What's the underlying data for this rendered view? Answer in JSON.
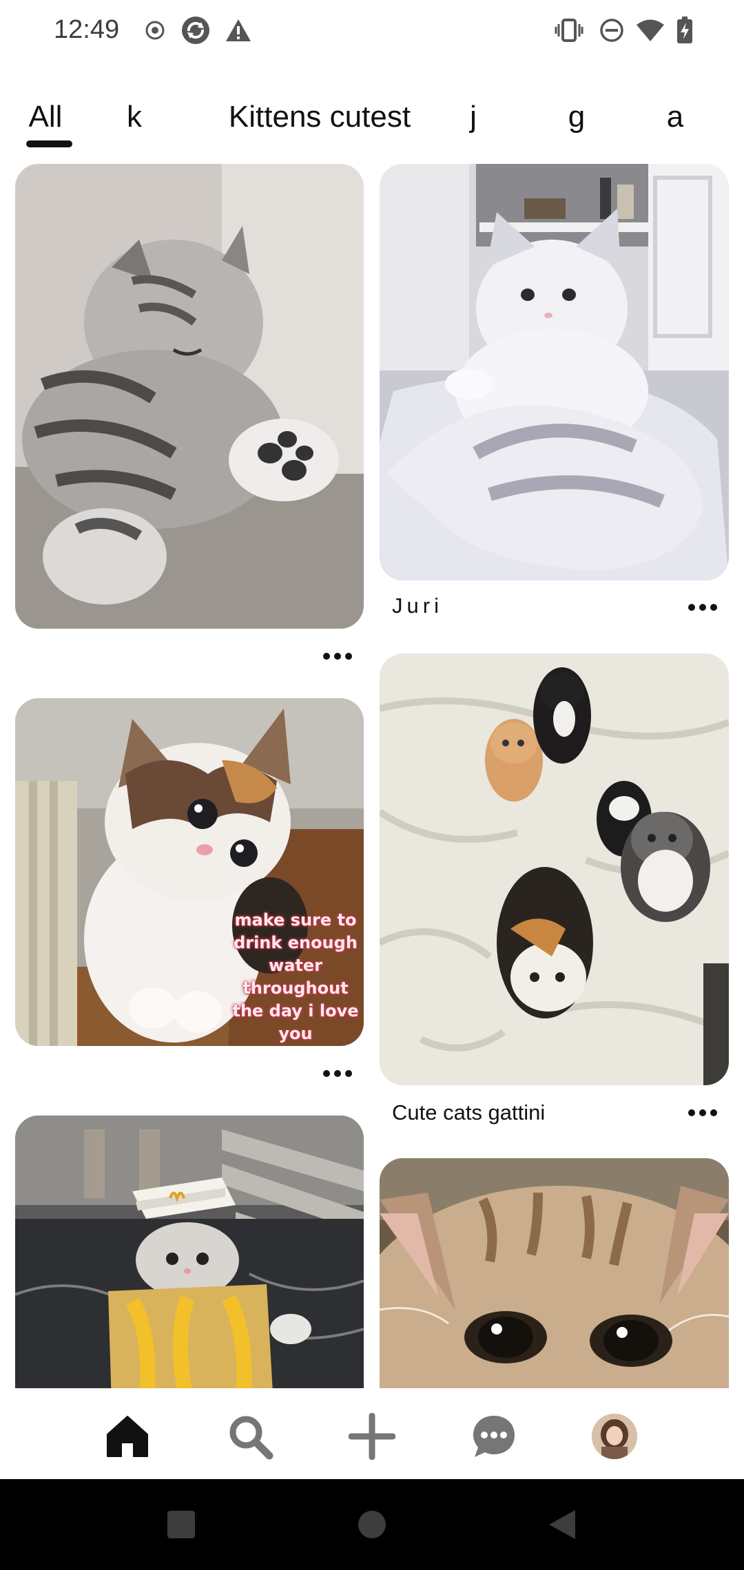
{
  "status_bar": {
    "time": "12:49",
    "left_icons": [
      "record-icon",
      "sync-icon",
      "warning-icon"
    ],
    "right_icons": [
      "vibrate-icon",
      "do-not-disturb-icon",
      "wifi-icon",
      "battery-charging-icon"
    ]
  },
  "tabs": [
    {
      "label": "All",
      "selected": true
    },
    {
      "label": "k",
      "selected": false
    },
    {
      "label": "Kittens cutest",
      "selected": false
    },
    {
      "label": "j",
      "selected": false
    },
    {
      "label": "g",
      "selected": false
    },
    {
      "label": "a",
      "selected": false
    }
  ],
  "pins": {
    "left": [
      {
        "title": "",
        "image": "sleeping-tabby-kitten"
      },
      {
        "title": "",
        "image": "calico-kitten",
        "overlay_text": "make sure to drink enough water throughout the day i love you"
      },
      {
        "title": "",
        "image": "kitten-in-mcdonalds-bag"
      }
    ],
    "right": [
      {
        "title": "Juri",
        "image": "fluffy-white-cat"
      },
      {
        "title": "Cute cats gattini",
        "image": "five-kittens-on-blanket"
      },
      {
        "title": "",
        "image": "tabby-kitten-closeup"
      }
    ]
  },
  "more_icon": "more-icon",
  "bottom_nav": [
    {
      "name": "home",
      "icon": "home-icon",
      "active": true
    },
    {
      "name": "search",
      "icon": "search-icon",
      "active": false
    },
    {
      "name": "create",
      "icon": "plus-icon",
      "active": false
    },
    {
      "name": "messages",
      "icon": "chat-icon",
      "active": false
    },
    {
      "name": "profile",
      "icon": "avatar",
      "active": false
    }
  ],
  "system_nav": [
    "recents-icon",
    "home-circle-icon",
    "back-icon"
  ],
  "colors": {
    "text": "#111111",
    "nav_icon": "#767676",
    "overlay_text": "#ffe9ee",
    "overlay_outline": "#c0394b"
  }
}
